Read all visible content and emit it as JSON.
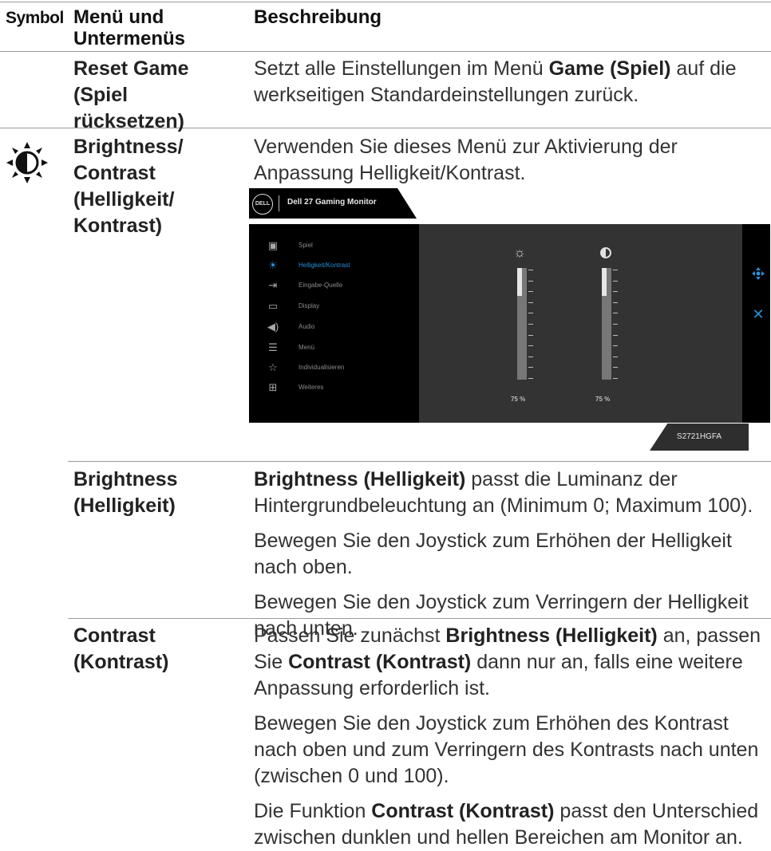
{
  "header": {
    "symbol": "Symbol",
    "menu_line1": "Menü und",
    "menu_line2": "Untermenüs",
    "description": "Beschreibung"
  },
  "reset_game": {
    "name_lines": [
      "Reset Game",
      "(Spiel",
      "rücksetzen)"
    ],
    "desc_line1_a": "Setzt alle Einstellungen im Menü ",
    "desc_line1_b": "Game (Spiel)",
    "desc_line1_c": " auf die",
    "desc_line2": "werkseitigen Standardeinstellungen zurück."
  },
  "brightness_contrast": {
    "icon": "brightness-contrast-icon",
    "name_lines": [
      "Brightness/",
      "Contrast",
      "(Helligkeit/",
      "Kontrast)"
    ],
    "desc_line1": "Verwenden Sie dieses Menü zur Aktivierung der",
    "desc_line2": "Anpassung Helligkeit/Kontrast."
  },
  "osd": {
    "logo": "DELL",
    "title": "Dell 27 Gaming Monitor",
    "menu_items": [
      {
        "label": "Spiel",
        "icon": "game-icon"
      },
      {
        "label": "Helligkeit/Kontrast",
        "icon": "brightness-icon"
      },
      {
        "label": "Eingabe-Quelle",
        "icon": "input-source-icon"
      },
      {
        "label": "Display",
        "icon": "display-icon"
      },
      {
        "label": "Audio",
        "icon": "audio-icon"
      },
      {
        "label": "Menü",
        "icon": "menu-icon"
      },
      {
        "label": "Individualisieren",
        "icon": "star-icon"
      },
      {
        "label": "Weiteres",
        "icon": "others-icon"
      }
    ],
    "brightness_value": "75 %",
    "contrast_value": "75 %",
    "brightness_level": 0.75,
    "contrast_level": 0.75,
    "model": "S2721HGFA",
    "accent": "#2a8fd6"
  },
  "brightness": {
    "name_lines": [
      "Brightness",
      "(Helligkeit)"
    ],
    "p1_bold": "Brightness (Helligkeit)",
    "p1_rest": " passt die Luminanz der",
    "p1_line2": "Hintergrundbeleuchtung an (Minimum 0; Maximum 100).",
    "p2_line1": "Bewegen Sie den Joystick zum Erhöhen der Helligkeit",
    "p2_line2": "nach oben.",
    "p3_line1": "Bewegen Sie den Joystick zum Verringern der Helligkeit",
    "p3_line2": "nach unten."
  },
  "contrast": {
    "name_lines": [
      "Contrast",
      "(Kontrast)"
    ],
    "p1_a": "Passen Sie zunächst ",
    "p1_b": "Brightness (Helligkeit)",
    "p1_c": " an, passen",
    "p1_d": "Sie ",
    "p1_e": "Contrast (Kontrast)",
    "p1_f": " dann nur an, falls eine weitere",
    "p1_line3": "Anpassung erforderlich ist.",
    "p2_line1": "Bewegen Sie den Joystick zum Erhöhen des Kontrast",
    "p2_line2": "nach oben und zum Verringern des Kontrasts nach unten",
    "p2_line3": "(zwischen 0 und 100).",
    "p3_a": "Die Funktion ",
    "p3_b": "Contrast (Kontrast)",
    "p3_c": " passt den Unterschied",
    "p3_line2": "zwischen dunklen und hellen Bereichen am Monitor an."
  }
}
